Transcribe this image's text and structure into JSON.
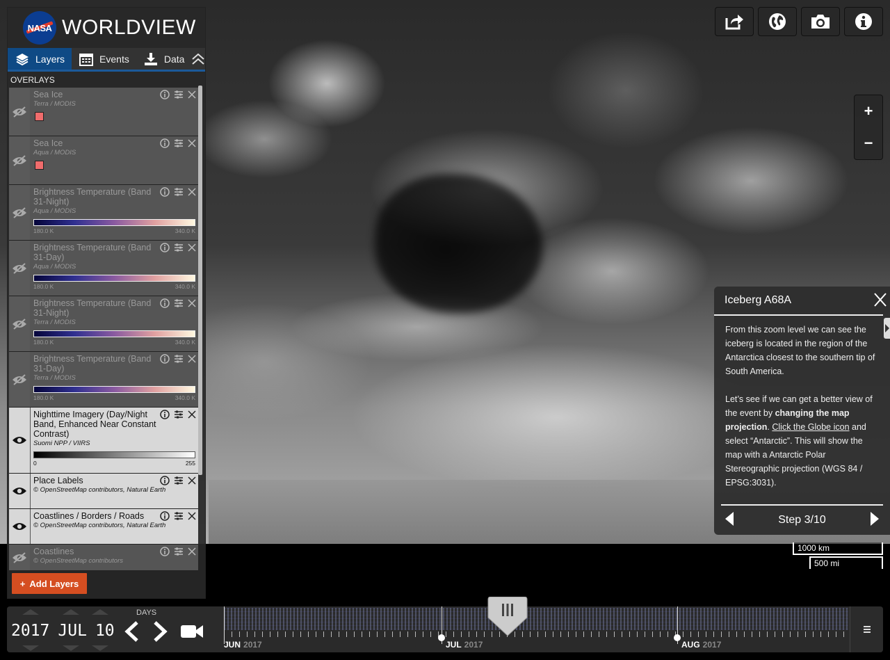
{
  "app": {
    "title": "WORLDVIEW",
    "logo_text": "NASA"
  },
  "tabs": [
    {
      "label": "Layers",
      "active": true
    },
    {
      "label": "Events",
      "active": false
    },
    {
      "label": "Data",
      "active": false
    }
  ],
  "overlays_title": "OVERLAYS",
  "layers": [
    {
      "name": "Sea Ice",
      "source": "Terra / MODIS",
      "visible": false,
      "legend": "swatch"
    },
    {
      "name": "Sea Ice",
      "source": "Aqua / MODIS",
      "visible": false,
      "legend": "swatch"
    },
    {
      "name": "Brightness Temperature (Band 31-Night)",
      "source": "Aqua / MODIS",
      "visible": false,
      "legend": "bt",
      "min": "180.0 K",
      "max": "340.0 K"
    },
    {
      "name": "Brightness Temperature (Band 31-Day)",
      "source": "Aqua / MODIS",
      "visible": false,
      "legend": "bt",
      "min": "180.0 K",
      "max": "340.0 K"
    },
    {
      "name": "Brightness Temperature (Band 31-Night)",
      "source": "Terra / MODIS",
      "visible": false,
      "legend": "bt",
      "min": "180.0 K",
      "max": "340.0 K"
    },
    {
      "name": "Brightness Temperature (Band 31-Day)",
      "source": "Terra / MODIS",
      "visible": false,
      "legend": "bt",
      "min": "180.0 K",
      "max": "340.0 K"
    },
    {
      "name": "Nighttime Imagery (Day/Night Band, Enhanced Near Constant Contrast)",
      "source": "Suomi NPP / VIIRS",
      "visible": true,
      "legend": "gray",
      "min": "0",
      "max": "255"
    },
    {
      "name": "Place Labels",
      "source": "© OpenStreetMap contributors, Natural Earth",
      "visible": true,
      "legend": "none"
    },
    {
      "name": "Coastlines / Borders / Roads",
      "source": "© OpenStreetMap contributors, Natural Earth",
      "visible": true,
      "legend": "none"
    },
    {
      "name": "Coastlines",
      "source": "© OpenStreetMap contributors",
      "visible": false,
      "legend": "none"
    }
  ],
  "add_layers_label": "Add Layers",
  "zoom": {
    "in": "+",
    "out": "−"
  },
  "tour": {
    "title": "Iceberg A68A",
    "p1": "From this zoom level we can see the iceberg is located in the region of the Antarctica closest to the southern tip of South America.",
    "p2_a": "Let’s see if we can get a better view of the event by ",
    "p2_bold": "changing the map projection",
    "p2_b": ". ",
    "p2_link": "Click the Globe icon",
    "p2_c": " and select “Antarctic”. This will show the map with a Antarctic Polar Stereographic projection (WGS 84 / EPSG:3031).",
    "step": "Step 3/10",
    "close": "X"
  },
  "scale": {
    "km": "1000 km",
    "mi": "500 mi"
  },
  "timeline": {
    "year": "2017",
    "month": "JUL",
    "day": "10",
    "interval_label": "DAYS",
    "months": [
      {
        "label": "JUN",
        "year": "2017"
      },
      {
        "label": "JUL",
        "year": "2017"
      },
      {
        "label": "AUG",
        "year": "2017"
      }
    ]
  },
  "colors": {
    "accent": "#0f4a85",
    "add_button": "#d54e21",
    "swatch": "#f06c6c"
  }
}
